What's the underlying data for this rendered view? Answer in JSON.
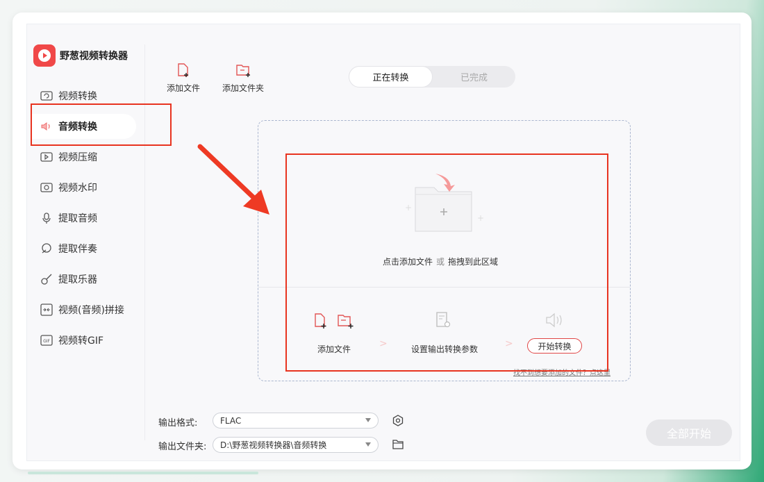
{
  "app": {
    "title": "野葱视频转换器"
  },
  "sidebar": {
    "items": [
      {
        "label": "视频转换",
        "icon": "video-convert-icon"
      },
      {
        "label": "音频转换",
        "icon": "speaker-icon",
        "active": true
      },
      {
        "label": "视频压缩",
        "icon": "compress-icon"
      },
      {
        "label": "视频水印",
        "icon": "watermark-icon"
      },
      {
        "label": "提取音频",
        "icon": "microphone-icon"
      },
      {
        "label": "提取伴奏",
        "icon": "accompaniment-icon"
      },
      {
        "label": "提取乐器",
        "icon": "guitar-icon"
      },
      {
        "label": "视频(音频)拼接",
        "icon": "merge-icon"
      },
      {
        "label": "视频转GIF",
        "icon": "gif-icon"
      }
    ]
  },
  "toolbar": {
    "add_file": "添加文件",
    "add_folder": "添加文件夹"
  },
  "tabs": [
    {
      "label": "正在转换",
      "active": true
    },
    {
      "label": "已完成"
    }
  ],
  "dropzone": {
    "hint_click": "点击添加文件",
    "hint_or": "或",
    "hint_drag": "拖拽到此区域",
    "steps": [
      {
        "label": "添加文件"
      },
      {
        "label": "设置输出转换参数"
      }
    ],
    "start_button": "开始转换",
    "help_link": "找不到想要添加的文件？点这里"
  },
  "bottom": {
    "format_label": "输出格式:",
    "format_value": "FLAC",
    "folder_label": "输出文件夹:",
    "folder_value": "D:\\野葱视频转换器\\音频转换",
    "start_all": "全部开始"
  },
  "colors": {
    "accent": "#f04848",
    "highlight": "#e8331f",
    "brand_green": "#2fa876"
  }
}
